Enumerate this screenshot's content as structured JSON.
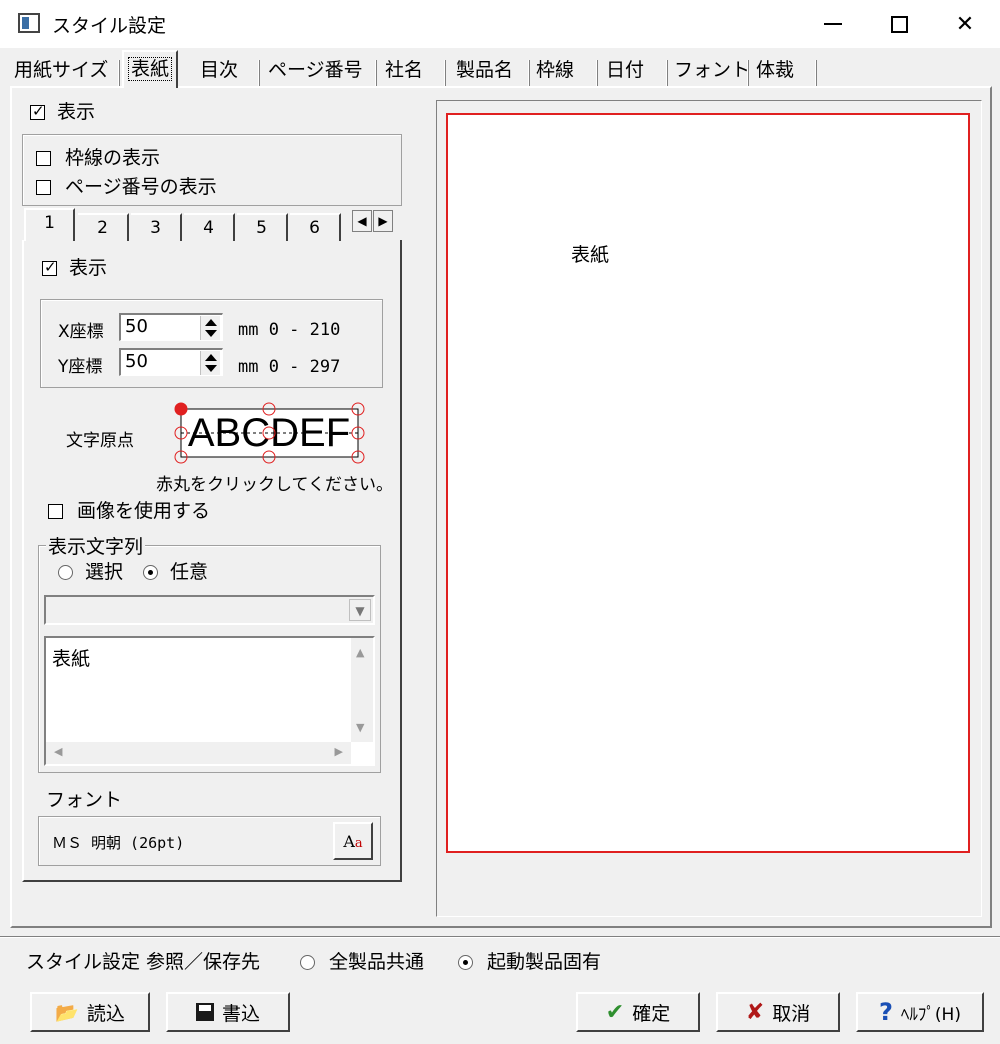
{
  "window": {
    "title": "スタイル設定"
  },
  "tabs": [
    "用紙サイズ",
    "表紙",
    "目次",
    "ページ番号",
    "社名",
    "製品名",
    "枠線",
    "日付",
    "フォント",
    "体裁"
  ],
  "active_tab": "表紙",
  "top_options": {
    "show_label": "表示",
    "show_checked": true,
    "frame_label": "枠線の表示",
    "frame_checked": false,
    "page_no_label": "ページ番号の表示",
    "page_no_checked": false
  },
  "inner_tabs": [
    "1",
    "2",
    "3",
    "4",
    "5",
    "6"
  ],
  "active_inner_tab": "1",
  "item": {
    "show_label": "表示",
    "show_checked": true,
    "x_label": "X座標",
    "x_value": "50",
    "x_range": "mm 0 - 210",
    "y_label": "Y座標",
    "y_value": "50",
    "y_range": "mm 0 - 297",
    "origin_label": "文字原点",
    "origin_sample": "ABCDEF",
    "origin_hint": "赤丸をクリックしてください。",
    "use_image_label": "画像を使用する",
    "use_image_checked": false,
    "text_group_label": "表示文字列",
    "radio_select_label": "選択",
    "radio_any_label": "任意",
    "selected_radio": "任意",
    "combo_value": "",
    "text_value": "表紙",
    "font_label": "フォント",
    "font_value": "ＭＳ 明朝 (26pt)"
  },
  "preview": {
    "text": "表紙",
    "frame_color": "#e02020"
  },
  "storage": {
    "label": "スタイル設定 参照／保存先",
    "common_label": "全製品共通",
    "specific_label": "起動製品固有",
    "selected": "起動製品固有"
  },
  "buttons": {
    "load": "読込",
    "save": "書込",
    "ok": "確定",
    "cancel": "取消",
    "help": "ﾍﾙﾌﾟ(H)"
  }
}
